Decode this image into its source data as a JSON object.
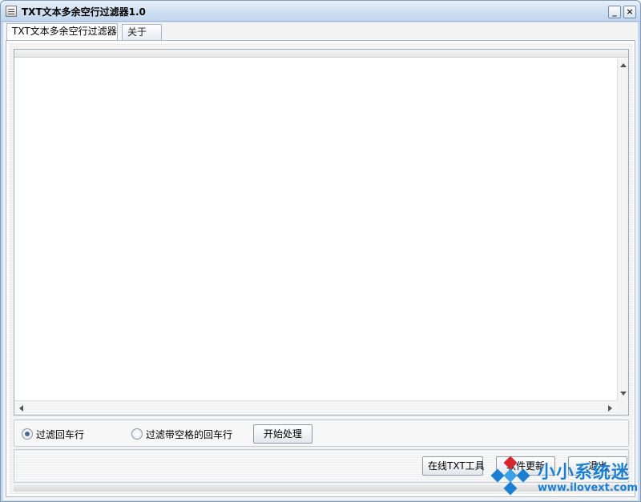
{
  "window": {
    "title": "TXT文本多余空行过滤器1.0",
    "minimize_glyph": "_",
    "close_glyph": "×"
  },
  "tabs": [
    {
      "label": "TXT文本多余空行过滤器",
      "selected": true
    },
    {
      "label": "关于",
      "selected": false
    }
  ],
  "editor": {
    "value": ""
  },
  "options": {
    "radio_filter_label": "过滤回车行",
    "radio_filter_checked": true,
    "radio_filter_space_label": "过滤带空格的回车行",
    "radio_filter_space_checked": false,
    "start_button": "开始处理"
  },
  "footer": {
    "online_tool_button": "在线TXT工具",
    "update_button": "软件更新",
    "exit_button": "退出"
  },
  "watermark": {
    "brand": "小小系统迷",
    "url": "www.ilovext.com"
  },
  "colors": {
    "title_bar": "#cfdff1",
    "watermark_blue": "#1c7fd2"
  }
}
